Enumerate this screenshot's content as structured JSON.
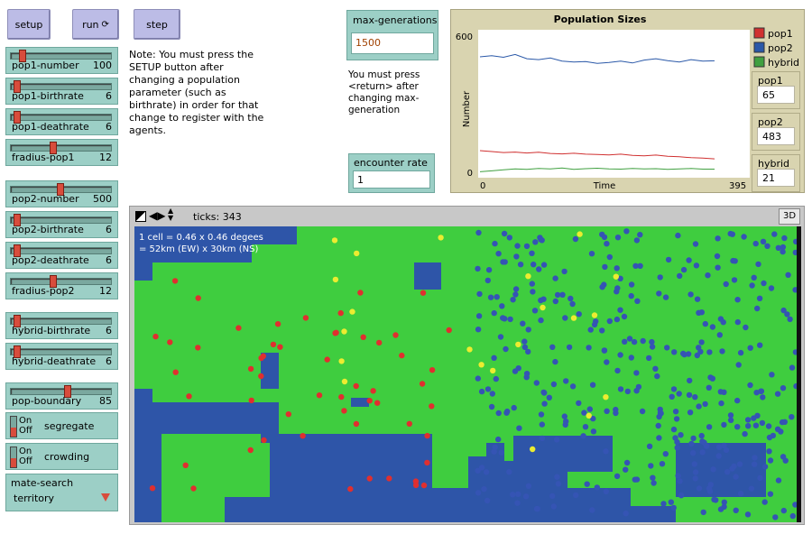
{
  "buttons": {
    "setup": "setup",
    "run": "run",
    "step": "step"
  },
  "note_setup": "Note: You must press the SETUP button after changing a population parameter (such as birthrate) in order for that change to register with the agents.",
  "note_return": "You must press <return> after changing max-generation",
  "sliders": [
    {
      "label": "pop1-number",
      "value": "100",
      "frac": 0.08
    },
    {
      "label": "pop1-birthrate",
      "value": "6",
      "frac": 0.02
    },
    {
      "label": "pop1-deathrate",
      "value": "6",
      "frac": 0.02
    },
    {
      "label": "fradius-pop1",
      "value": "12",
      "frac": 0.4
    },
    {
      "label": "pop2-number",
      "value": "500",
      "frac": 0.48
    },
    {
      "label": "pop2-birthrate",
      "value": "6",
      "frac": 0.02
    },
    {
      "label": "pop2-deathrate",
      "value": "6",
      "frac": 0.02
    },
    {
      "label": "fradius-pop2",
      "value": "12",
      "frac": 0.4
    },
    {
      "label": "hybrid-birthrate",
      "value": "6",
      "frac": 0.02
    },
    {
      "label": "hybrid-deathrate",
      "value": "6",
      "frac": 0.02
    },
    {
      "label": "pop-boundary",
      "value": "85",
      "frac": 0.55
    }
  ],
  "switches": [
    {
      "label": "segregate",
      "on": "On",
      "off": "Off"
    },
    {
      "label": "crowding",
      "on": "On",
      "off": "Off"
    }
  ],
  "chooser": {
    "label": "mate-search",
    "value": "territory"
  },
  "inputs": {
    "max_generations": {
      "label": "max-generations",
      "value": "1500"
    },
    "encounter_rate": {
      "label": "encounter rate",
      "value": "1"
    }
  },
  "monitors": [
    {
      "label": "pop1",
      "value": "65"
    },
    {
      "label": "pop2",
      "value": "483"
    },
    {
      "label": "hybrid",
      "value": "21"
    }
  ],
  "view": {
    "ticks_label": "ticks: 343",
    "btn3d": "3D",
    "caption1": "1 cell = 0.46 x 0.46 degees",
    "caption2": "= 52km (EW) x 30km (NS)"
  },
  "chart_data": {
    "type": "line",
    "title": "Population Sizes",
    "xlabel": "Time",
    "ylabel": "Number",
    "xlim": [
      0,
      395
    ],
    "ylim": [
      0,
      600
    ],
    "x_tick_labels": [
      "0",
      "395"
    ],
    "y_tick_labels": [
      "0",
      "600"
    ],
    "legend_position": "right",
    "series": [
      {
        "name": "pop1",
        "color": "#d03030",
        "values": [
          100,
          96,
          92,
          94,
          90,
          93,
          88,
          86,
          89,
          85,
          84,
          82,
          85,
          80,
          78,
          81,
          76,
          74,
          70,
          68,
          65
        ]
      },
      {
        "name": "pop2",
        "color": "#2a58a8",
        "values": [
          500,
          505,
          498,
          510,
          492,
          488,
          495,
          482,
          478,
          480,
          472,
          476,
          482,
          474,
          486,
          492,
          484,
          478,
          488,
          482,
          483
        ]
      },
      {
        "name": "hybrid",
        "color": "#40a040",
        "values": [
          10,
          14,
          18,
          22,
          20,
          24,
          22,
          26,
          20,
          23,
          25,
          22,
          21,
          24,
          22,
          23,
          20,
          22,
          24,
          21,
          21
        ]
      }
    ]
  },
  "colors": {
    "land": "#3fcd3f",
    "water": "#2e55a8",
    "pop1": "#e02f2f",
    "pop2": "#3554b4",
    "hybrid": "#ecec30"
  }
}
